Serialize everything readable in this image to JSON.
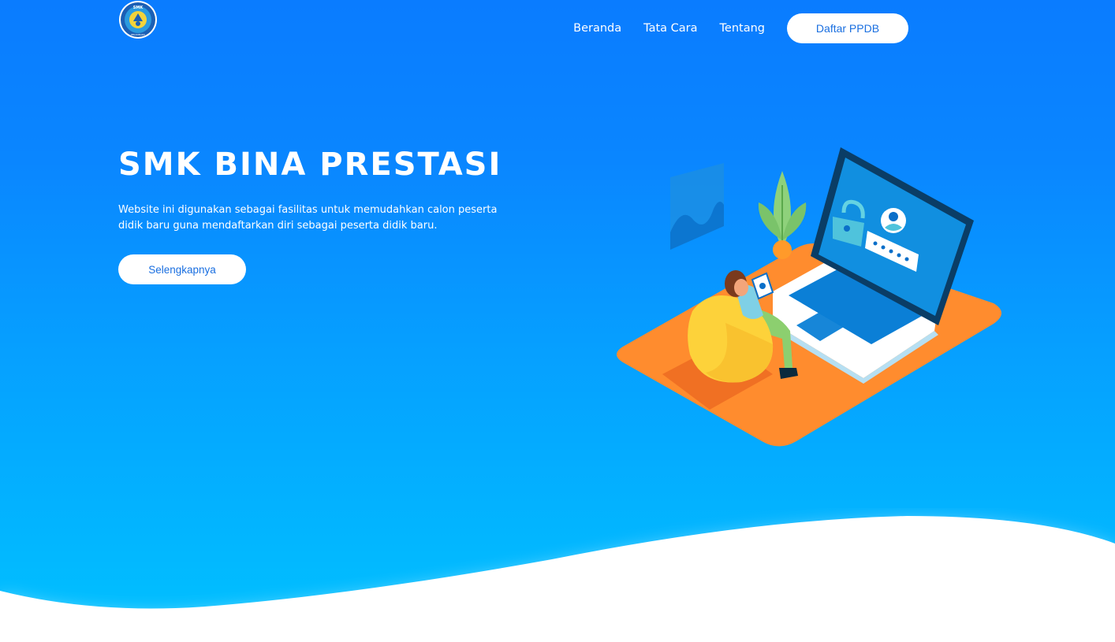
{
  "header": {
    "logo_alt": "SMK",
    "logo_text_bottom": "PEKANBARU",
    "nav": [
      {
        "label": "Beranda"
      },
      {
        "label": "Tata Cara"
      },
      {
        "label": "Tentang"
      }
    ],
    "cta_label": "Daftar PPDB"
  },
  "hero": {
    "title": "SMK BINA PRESTASI",
    "description": "Website ini digunakan sebagai fasilitas untuk memudahkan calon peserta didik baru guna mendaftarkan diri sebagai peserta didik baru.",
    "button_label": "Selengkapnya"
  },
  "colors": {
    "gradient_top": "#0a7cff",
    "gradient_bottom": "#00c2ff",
    "button_text": "#1a6fe0",
    "platform_orange": "#ff8c2e",
    "chair_yellow": "#fdd23a"
  },
  "icons": [
    "school-logo-icon",
    "login-illustration",
    "padlock-icon",
    "user-avatar-icon",
    "plant-icon"
  ]
}
